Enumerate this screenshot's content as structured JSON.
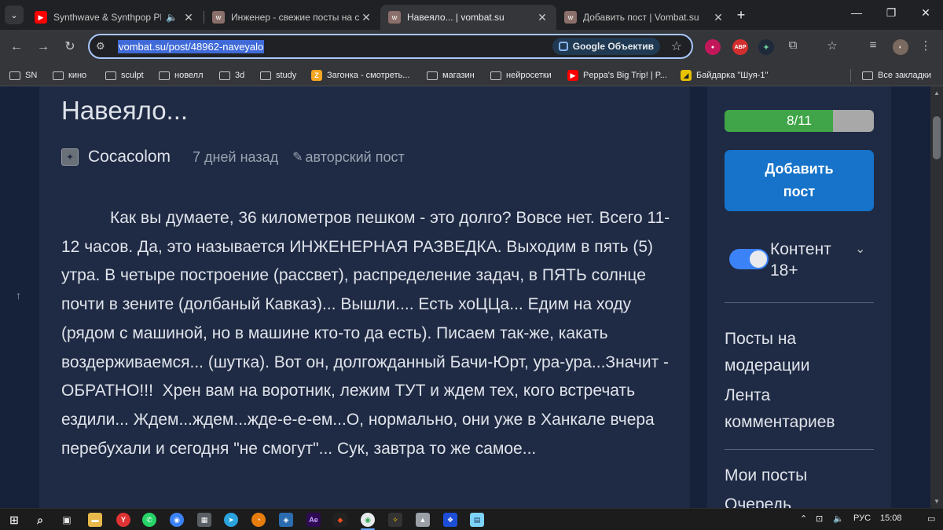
{
  "tabs": [
    {
      "title": "Synthwave & Synthpop PLE",
      "favicon": "youtube-icon",
      "audio": true,
      "active": false
    },
    {
      "title": "Инженер - свежие посты на с",
      "favicon": "wombat-icon",
      "audio": false,
      "active": false
    },
    {
      "title": "Навеяло... | vombat.su",
      "favicon": "wombat-icon",
      "audio": false,
      "active": true
    },
    {
      "title": "Добавить пост | Vombat.su",
      "favicon": "wombat-icon",
      "audio": false,
      "active": false
    }
  ],
  "toolbar": {
    "url": "vombat.su/post/48962-naveyalo",
    "lens_label": "Google Объектив"
  },
  "extensions": {
    "abp": "ABP"
  },
  "bookmarks": [
    {
      "label": "SN",
      "type": "folder"
    },
    {
      "label": "кино",
      "type": "folder"
    },
    {
      "label": "sculpt",
      "type": "folder"
    },
    {
      "label": "новелл",
      "type": "folder"
    },
    {
      "label": "3d",
      "type": "folder"
    },
    {
      "label": "study",
      "type": "folder"
    },
    {
      "label": "Загонка - смотреть...",
      "type": "site"
    },
    {
      "label": "магазин",
      "type": "folder"
    },
    {
      "label": "нейросетки",
      "type": "folder"
    },
    {
      "label": "Peppa's Big Trip! | P...",
      "type": "youtube"
    },
    {
      "label": "Байдарка \"Шуя-1\"",
      "type": "site"
    }
  ],
  "all_bookmarks": "Все закладки",
  "post": {
    "title": "Навеяло...",
    "author": "Cocacolom",
    "date": "7 дней назад",
    "tag": "авторский пост",
    "body": "Как вы думаете, 36 километров пешком - это долго? Вовсе нет. Всего 11-12 часов. Да, это называется ИНЖЕНЕРНАЯ РАЗВЕДКА. Выходим в пять (5) утра. В четыре построение (рассвет), распределение задач, в ПЯТЬ солнце почти в зените (долбаный Кавказ)... Вышли.... Есть хоЦЦа... Едим на ходу (рядом с машиной, но в машине кто-то да есть). Писаем так-же, какать воздерживаемся... (шутка). Вот он, долгожданный Бачи-Юрт, ура-ура...Значит - ОБРАТНО!!!  Хрен вам на воротник, лежим ТУТ и ждем тех, кого встречать ездили... Ждем...ждем...жде-е-е-ем...О, нормально, они уже в Ханкале вчера перебухали и сегодня \"не смогут\"... Сук, завтра то же самое..."
  },
  "sidebar": {
    "progress": {
      "label": "8/11",
      "value": 8,
      "max": 11
    },
    "add_post": "Добавить пост",
    "content_toggle": {
      "label": "Контент 18+",
      "on": true
    },
    "links": [
      "Посты на модерации",
      "Лента комментариев",
      "Мои посты",
      "Очередь"
    ]
  },
  "taskbar": {
    "lang": "РУС",
    "time": "15:08"
  },
  "colors": {
    "page_bg": "#16213a",
    "card_bg": "#1f2a44",
    "accent_blue": "#1673c9",
    "progress_green": "#3fa548"
  }
}
